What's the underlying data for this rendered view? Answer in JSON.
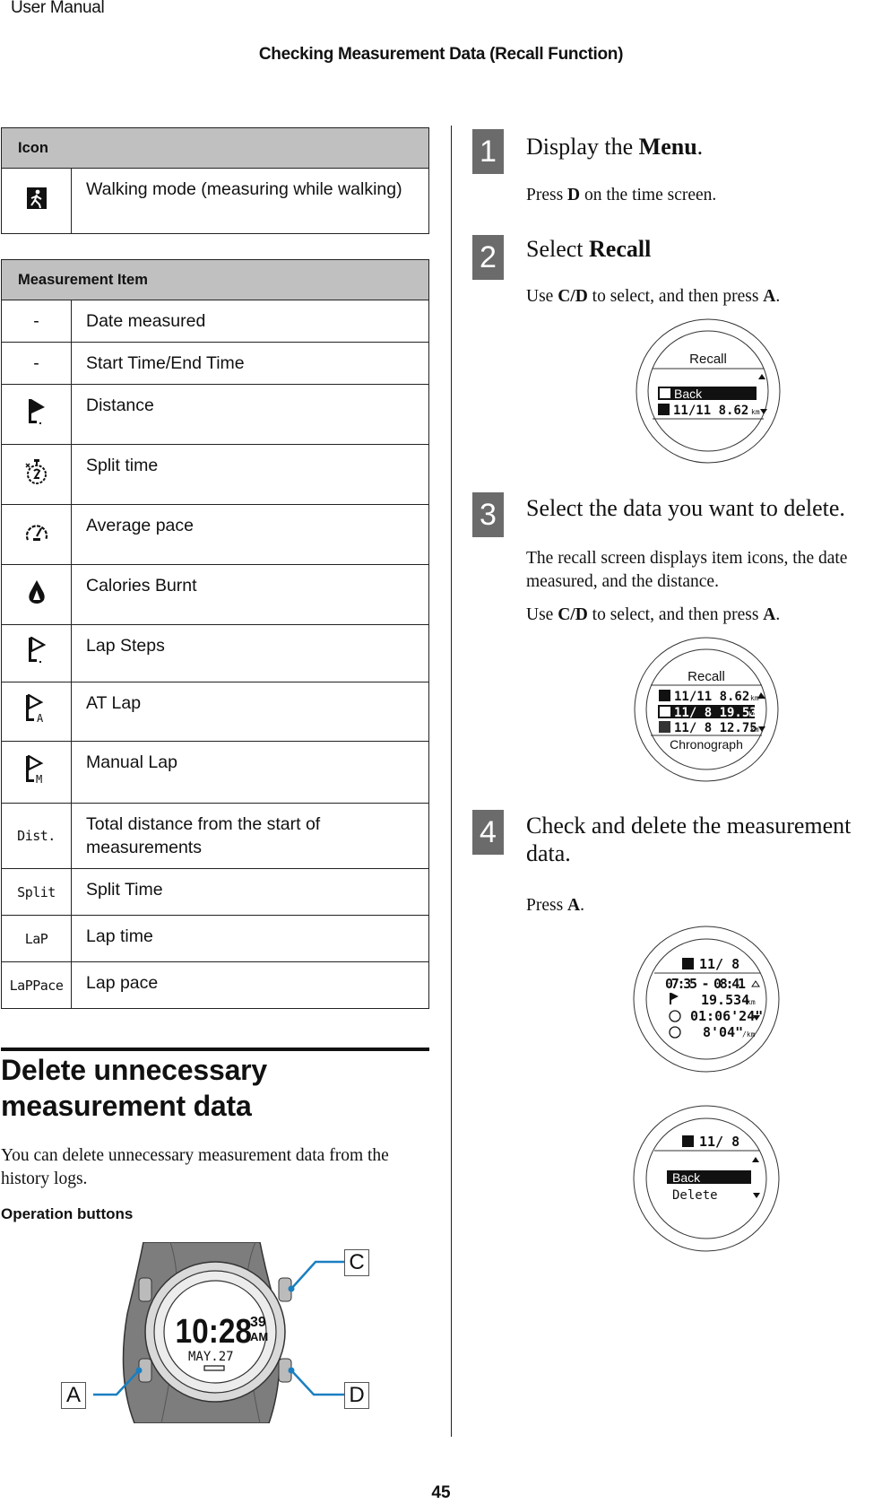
{
  "header": {
    "doc_label": "User Manual",
    "chapter_title": "Checking Measurement Data (Recall Function)"
  },
  "icon_table": {
    "header": "Icon",
    "rows": [
      {
        "icon": "walking-mode-icon",
        "description": "Walking mode (measuring while walking)"
      }
    ]
  },
  "measurement_table": {
    "header": "Measurement Item",
    "rows": [
      {
        "icon_text": "-",
        "icon": "none",
        "description": "Date measured"
      },
      {
        "icon_text": "-",
        "icon": "none",
        "description": "Start Time/End Time"
      },
      {
        "icon_text": "",
        "icon": "distance-flag-icon",
        "description": "Distance"
      },
      {
        "icon_text": "",
        "icon": "stopwatch-icon",
        "description": "Split time"
      },
      {
        "icon_text": "",
        "icon": "pace-gauge-icon",
        "description": "Average pace"
      },
      {
        "icon_text": "",
        "icon": "flame-icon",
        "description": "Calories Burnt"
      },
      {
        "icon_text": "",
        "icon": "lap-flag-icon",
        "description": "Lap Steps"
      },
      {
        "icon_text": "",
        "icon": "auto-lap-flag-icon",
        "description": "AT Lap"
      },
      {
        "icon_text": "",
        "icon": "manual-lap-flag-icon",
        "description": "Manual Lap"
      },
      {
        "icon_text": "Dist.",
        "icon": "dist-label-icon",
        "description": "Total distance from the start of measurements"
      },
      {
        "icon_text": "Split",
        "icon": "split-label-icon",
        "description": "Split Time"
      },
      {
        "icon_text": "LaP",
        "icon": "lap-label-icon",
        "description": "Lap time"
      },
      {
        "icon_text": "LaPPace",
        "icon": "lappace-label-icon",
        "description": "Lap pace"
      }
    ]
  },
  "section": {
    "title": "Delete unnecessary measurement data",
    "intro": "You can delete unnecessary measurement data from the history logs.",
    "operation_buttons_label": "Operation buttons"
  },
  "watch_figure": {
    "time": "10:28",
    "seconds": "39",
    "ampm": "AM",
    "date": "MAY.27",
    "callouts": [
      "A",
      "C",
      "D"
    ],
    "callout_color": "#1a7fc1"
  },
  "steps": [
    {
      "number": "1",
      "title_pre": "Display the ",
      "title_bold": "Menu",
      "title_post": ".",
      "body": [
        {
          "pre": "Press ",
          "bold": "D",
          "post": " on the time screen."
        }
      ]
    },
    {
      "number": "2",
      "title_pre": "Select ",
      "title_bold": "Recall",
      "title_post": "",
      "body": [
        {
          "pre": "Use ",
          "bold": "C/D",
          "post": " to select, and then press ",
          "bold2": "A",
          "post2": "."
        }
      ],
      "screen": {
        "title": "Recall",
        "rows": [
          {
            "icon": "back-icon",
            "text": "Back",
            "selected": true
          },
          {
            "icon": "walking-mode-icon",
            "text": "11/11  8.62",
            "unit": "km",
            "selected": false
          }
        ]
      }
    },
    {
      "number": "3",
      "title_pre": "Select the data you want to delete.",
      "title_bold": "",
      "title_post": "",
      "body": [
        {
          "pre": "The recall screen displays item icons, the date measured, and the distance."
        },
        {
          "pre": "Use ",
          "bold": "C/D",
          "post": " to select, and then press ",
          "bold2": "A",
          "post2": "."
        }
      ],
      "screen": {
        "title": "Recall",
        "rows": [
          {
            "icon": "walking-mode-icon",
            "text": "11/11  8.62",
            "unit": "km",
            "selected": false
          },
          {
            "icon": "running-mode-icon",
            "text": "11/ 8 19.53",
            "unit": "km",
            "selected": true
          },
          {
            "icon": "cycling-mode-icon",
            "text": "11/ 8 12.75",
            "unit": "km",
            "selected": false
          }
        ],
        "footer": "Chronograph"
      }
    },
    {
      "number": "4",
      "title_pre": "Check and delete the measurement data.",
      "title_bold": "",
      "title_post": "",
      "body": [
        {
          "pre": "Press ",
          "bold": "A",
          "post": "."
        }
      ],
      "screen_detail": {
        "header": "11/ 8",
        "time_range": "07:35 - 08:41",
        "distance": "19.534",
        "distance_unit": "km",
        "split_time": "01:06'24\"",
        "pace": "8'04\"",
        "pace_unit": "/km"
      },
      "screen_menu": {
        "header": "11/ 8",
        "options": [
          {
            "text": "Back",
            "selected": true
          },
          {
            "text": "Delete",
            "selected": false
          }
        ]
      }
    }
  ],
  "footer": {
    "page_number": "45"
  }
}
